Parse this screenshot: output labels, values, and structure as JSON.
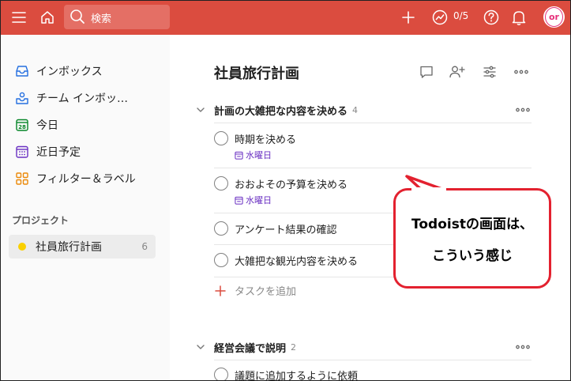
{
  "topbar": {
    "search_placeholder": "検索",
    "karma_count": "0/5",
    "avatar_initials": "or",
    "colors": {
      "bar": "#db4c3f"
    }
  },
  "sidebar": {
    "items": [
      {
        "label": "インボックス",
        "icon": "inbox-icon"
      },
      {
        "label": "チーム インボッ…",
        "icon": "team-inbox-icon"
      },
      {
        "label": "今日",
        "icon": "calendar-today-icon"
      },
      {
        "label": "近日予定",
        "icon": "calendar-upcoming-icon"
      },
      {
        "label": "フィルター＆ラベル",
        "icon": "filters-labels-icon"
      }
    ],
    "projects_label": "プロジェクト",
    "projects": [
      {
        "label": "社員旅行計画",
        "count": "6",
        "color": "#fad000"
      }
    ]
  },
  "main": {
    "title": "社員旅行計画",
    "sections": [
      {
        "title": "計画の大雑把な内容を決める",
        "count": "4",
        "tasks": [
          {
            "text": "時期を決める",
            "due": "水曜日"
          },
          {
            "text": "おおよその予算を決める",
            "due": "水曜日"
          },
          {
            "text": "アンケート結果の確認",
            "due": ""
          },
          {
            "text": "大雑把な観光内容を決める",
            "due": ""
          }
        ],
        "add_task": "タスクを追加"
      },
      {
        "title": "経営会議で説明",
        "count": "2",
        "tasks": [
          {
            "text": "議題に追加するように依頼",
            "due": ""
          }
        ]
      }
    ]
  },
  "callout": {
    "line1": "Todoistの画面は、",
    "line2": "こういう感じ",
    "border_color": "#e3212f"
  }
}
